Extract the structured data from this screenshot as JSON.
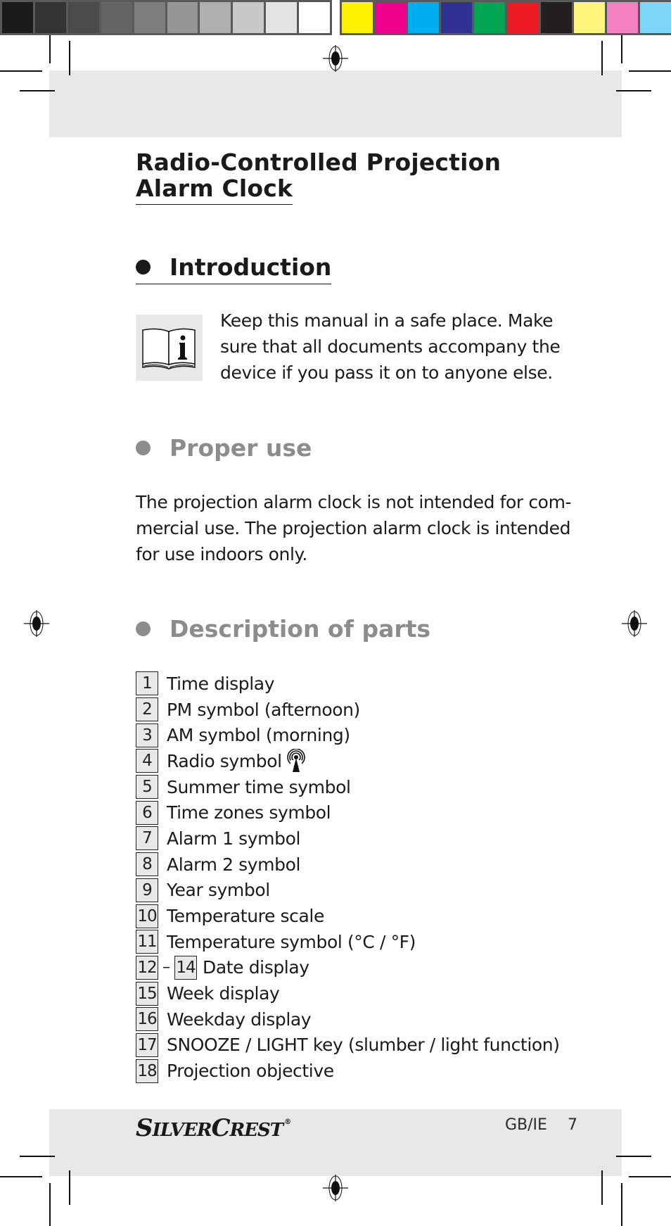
{
  "print_marks": {
    "gray_swatches": [
      "#1b1b1b",
      "#333333",
      "#4b4b4b",
      "#646464",
      "#7d7d7d",
      "#969696",
      "#afafaf",
      "#c8c8c8",
      "#e4e4e4",
      "#ffffff"
    ],
    "color_swatches": [
      "#fff200",
      "#ec008c",
      "#00aeef",
      "#2e3192",
      "#00a651",
      "#ed1c24",
      "#231f20",
      "#fff57d",
      "#f482c2",
      "#7dd6f7"
    ],
    "registration_icon": "registration-mark-icon"
  },
  "document": {
    "title_line1": "Radio-Controlled Projection",
    "title_line2": "Alarm Clock",
    "sections": {
      "introduction": {
        "heading": "Introduction",
        "icon": "info-book-icon",
        "text_lines": [
          "Keep this manual in a safe place. Make",
          "sure that all documents accompany the",
          "device if you pass it on to anyone else."
        ]
      },
      "proper_use": {
        "heading": "Proper use",
        "text_lines": [
          "The projection alarm clock is not intended for com-",
          "mercial use. The projection alarm clock is intended",
          "for use indoors only."
        ]
      },
      "description_of_parts": {
        "heading": "Description of parts",
        "parts": [
          {
            "num": "1",
            "label": "Time display"
          },
          {
            "num": "2",
            "label": "PM symbol (afternoon)"
          },
          {
            "num": "3",
            "label": "AM symbol (morning)"
          },
          {
            "num": "4",
            "label": "Radio symbol",
            "icon": "radio-antenna-icon"
          },
          {
            "num": "5",
            "label": "Summer time symbol"
          },
          {
            "num": "6",
            "label": "Time zones symbol"
          },
          {
            "num": "7",
            "label": "Alarm 1 symbol"
          },
          {
            "num": "8",
            "label": "Alarm 2 symbol"
          },
          {
            "num": "9",
            "label": "Year symbol"
          },
          {
            "num": "10",
            "label": "Temperature scale"
          },
          {
            "num": "11",
            "label": "Temperature symbol (°C / °F)"
          },
          {
            "num": "12",
            "num_end": "14",
            "dash": "–",
            "label": "Date display"
          },
          {
            "num": "15",
            "label": "Week display"
          },
          {
            "num": "16",
            "label": "Weekday display"
          },
          {
            "num": "17",
            "label": "SNOOZE / LIGHT key (slumber / light function)"
          },
          {
            "num": "18",
            "label": "Projection objective"
          }
        ]
      }
    }
  },
  "footer": {
    "brand_s": "S",
    "brand_ilver": "ILVER",
    "brand_c": "C",
    "brand_rest": "REST",
    "brand_reg": "®",
    "region": "GB/IE",
    "page_number": "7"
  }
}
